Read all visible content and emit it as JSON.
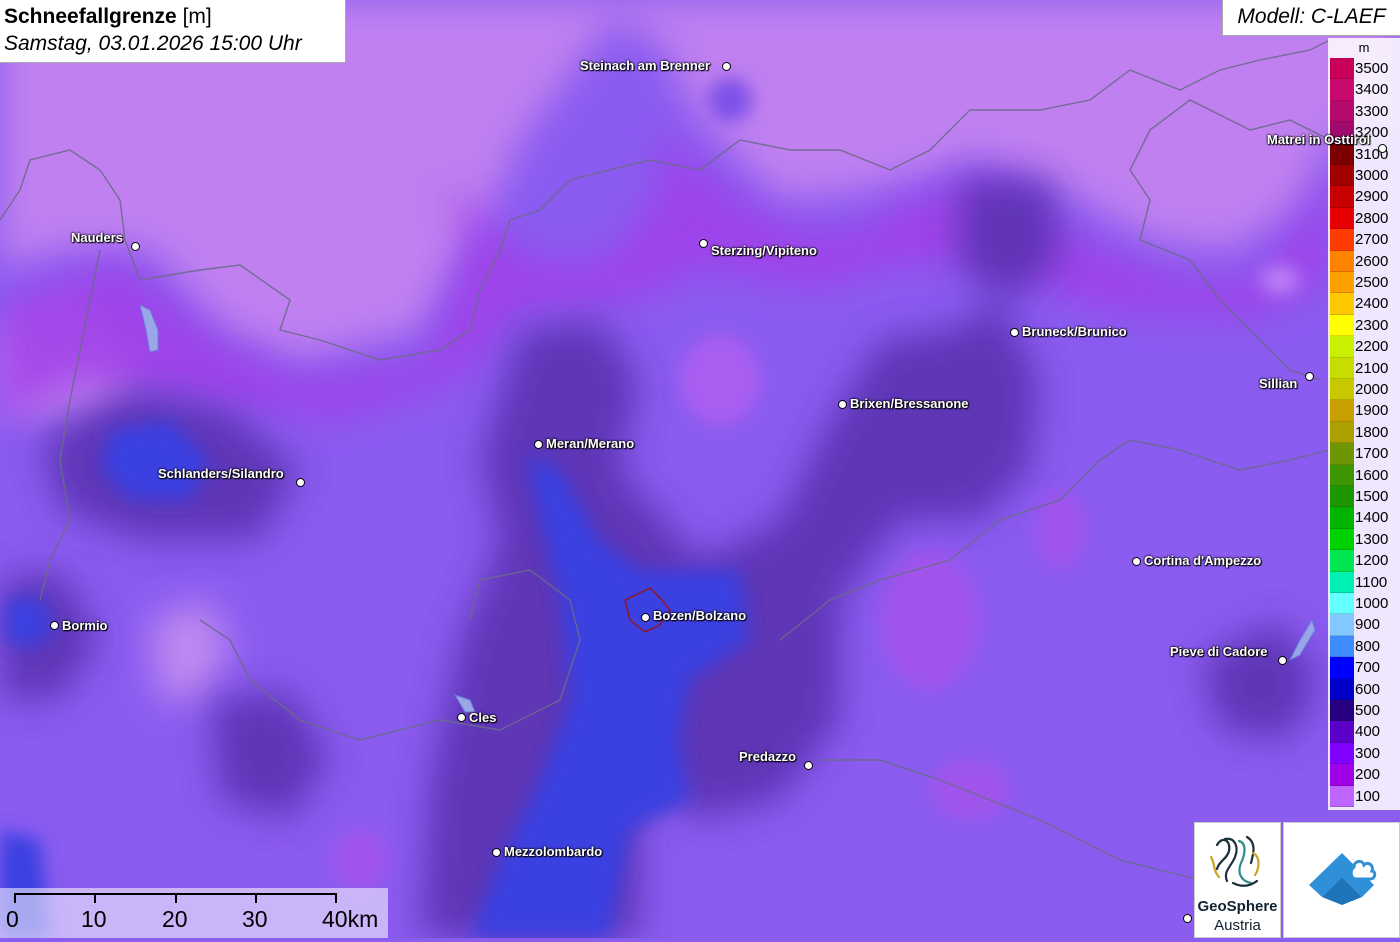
{
  "header": {
    "title": "Schneefallgrenze",
    "unit": "[m]",
    "datetime": "Samstag, 03.01.2026 15:00 Uhr"
  },
  "model": "Modell: C-LAEF",
  "legend": {
    "unit": "m",
    "entries": [
      {
        "value": "3500",
        "color": "#c8005a"
      },
      {
        "value": "3400",
        "color": "#c80a6e"
      },
      {
        "value": "3300",
        "color": "#b40a6e"
      },
      {
        "value": "3200",
        "color": "#a00a6e"
      },
      {
        "value": "3100",
        "color": "#7d0000"
      },
      {
        "value": "3000",
        "color": "#a00000"
      },
      {
        "value": "2900",
        "color": "#c80000"
      },
      {
        "value": "2800",
        "color": "#e60000"
      },
      {
        "value": "2700",
        "color": "#ff3c00"
      },
      {
        "value": "2600",
        "color": "#ff8200"
      },
      {
        "value": "2500",
        "color": "#ffa000"
      },
      {
        "value": "2400",
        "color": "#ffc800"
      },
      {
        "value": "2300",
        "color": "#ffff00"
      },
      {
        "value": "2200",
        "color": "#c8f000"
      },
      {
        "value": "2100",
        "color": "#c8dc00"
      },
      {
        "value": "2000",
        "color": "#c8c800"
      },
      {
        "value": "1900",
        "color": "#c8a000"
      },
      {
        "value": "1800",
        "color": "#aaa000"
      },
      {
        "value": "1700",
        "color": "#6e9600"
      },
      {
        "value": "1600",
        "color": "#3c9600"
      },
      {
        "value": "1500",
        "color": "#1e9600"
      },
      {
        "value": "1400",
        "color": "#00b400"
      },
      {
        "value": "1300",
        "color": "#00d200"
      },
      {
        "value": "1200",
        "color": "#00e650"
      },
      {
        "value": "1100",
        "color": "#00f0b4"
      },
      {
        "value": "1000",
        "color": "#64ffff"
      },
      {
        "value": "900",
        "color": "#82c8ff"
      },
      {
        "value": "800",
        "color": "#3c8cff"
      },
      {
        "value": "700",
        "color": "#0000ff"
      },
      {
        "value": "600",
        "color": "#0000c8"
      },
      {
        "value": "500",
        "color": "#280082"
      },
      {
        "value": "400",
        "color": "#5a00c8"
      },
      {
        "value": "300",
        "color": "#8200ff"
      },
      {
        "value": "200",
        "color": "#a000e6"
      },
      {
        "value": "100",
        "color": "#be64ff"
      }
    ]
  },
  "cities": [
    {
      "name": "Steinach am Brenner"
    },
    {
      "name": "Nauders"
    },
    {
      "name": "Sterzing/Vipiteno"
    },
    {
      "name": "Matrei in Osttirol"
    },
    {
      "name": "Bruneck/Brunico"
    },
    {
      "name": "Sillian"
    },
    {
      "name": "Brixen/Bressanone"
    },
    {
      "name": "Meran/Merano"
    },
    {
      "name": "Schlanders/Silandro"
    },
    {
      "name": "Cortina d'Ampezzo"
    },
    {
      "name": "Bormio"
    },
    {
      "name": "Bozen/Bolzano"
    },
    {
      "name": "Pieve di Cadore"
    },
    {
      "name": "Cles"
    },
    {
      "name": "Predazzo"
    },
    {
      "name": "Mezzolombardo"
    }
  ],
  "scale": {
    "labels": [
      "0",
      "10",
      "20",
      "30",
      "40km"
    ]
  },
  "logos": {
    "geosphere_line1": "GeoSphere",
    "geosphere_line2": "Austria"
  }
}
